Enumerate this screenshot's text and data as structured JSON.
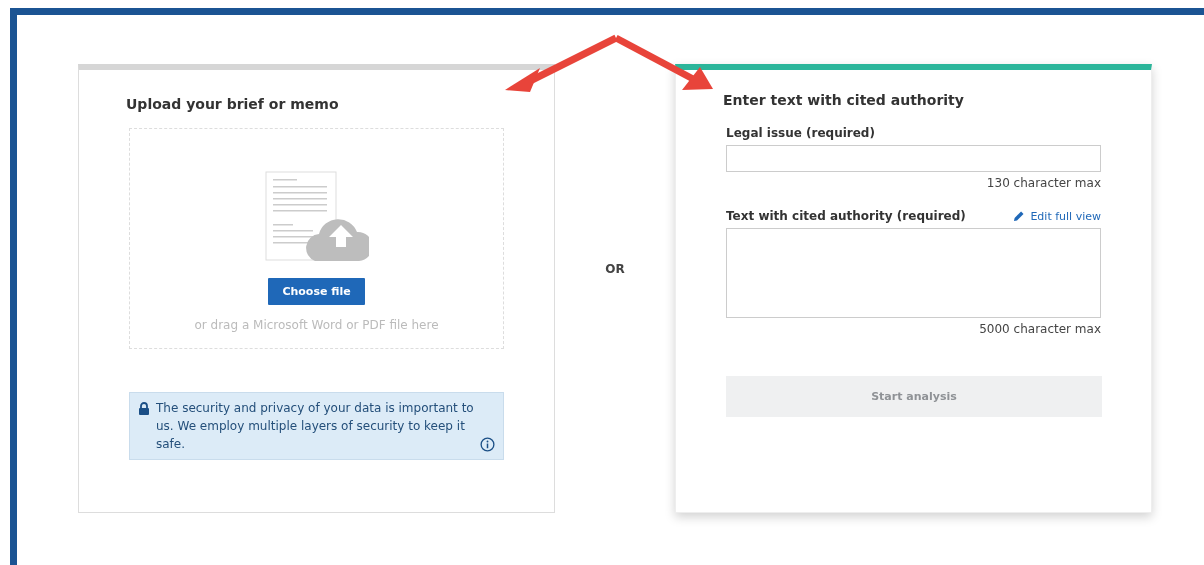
{
  "upload_panel": {
    "selected": false,
    "title": "Upload your brief or memo",
    "choose_button": "Choose file",
    "drop_hint": "or drag a Microsoft Word or PDF file here",
    "security_notice": "The security and privacy of your data is important to us. We employ multiple layers of security to keep it safe."
  },
  "divider_label": "OR",
  "text_panel": {
    "selected": true,
    "title": "Enter text with cited authority",
    "fields": [
      {
        "kind": "input",
        "label": "Legal issue (required)",
        "limit": "130 character max"
      },
      {
        "kind": "textarea",
        "label": "Text with cited authority (required)",
        "link": "Edit full view",
        "limit": "5000 character max"
      }
    ],
    "submit_button": {
      "label": "Start analysis",
      "disabled": true
    }
  }
}
